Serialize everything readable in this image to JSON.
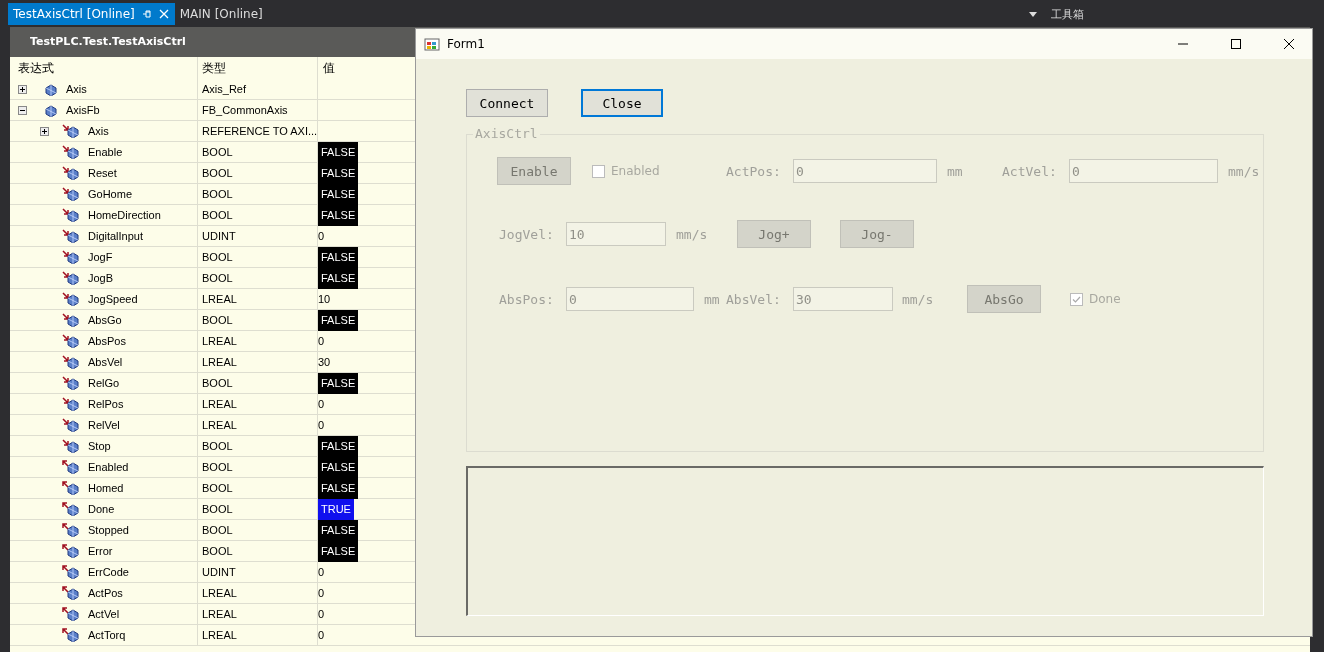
{
  "ide": {
    "tabs": [
      {
        "label": "TestAxisCtrl [Online]",
        "selected": true
      },
      {
        "label": "MAIN [Online]",
        "selected": false
      }
    ],
    "toolbox_label": "工具箱"
  },
  "watch": {
    "title": "TestPLC.Test.TestAxisCtrl",
    "columns": [
      "表达式",
      "类型",
      "值"
    ],
    "rows": [
      {
        "name": "Axis",
        "type": "Axis_Ref",
        "kind": "var",
        "expanded": false
      },
      {
        "name": "AxisFb",
        "type": "FB_CommonAxis",
        "kind": "var",
        "expanded": true,
        "children": [
          {
            "name": "Axis",
            "type": "REFERENCE TO AXI...",
            "kind": "input",
            "expanded": false
          },
          {
            "name": "Enable",
            "type": "BOOL",
            "kind": "input",
            "value": {
              "text": "FALSE",
              "kind": "bool",
              "on": false
            }
          },
          {
            "name": "Reset",
            "type": "BOOL",
            "kind": "input",
            "value": {
              "text": "FALSE",
              "kind": "bool",
              "on": false
            }
          },
          {
            "name": "GoHome",
            "type": "BOOL",
            "kind": "input",
            "value": {
              "text": "FALSE",
              "kind": "bool",
              "on": false
            }
          },
          {
            "name": "HomeDirection",
            "type": "BOOL",
            "kind": "input",
            "value": {
              "text": "FALSE",
              "kind": "bool",
              "on": false
            }
          },
          {
            "name": "DigitalInput",
            "type": "UDINT",
            "kind": "input",
            "value": {
              "text": "0",
              "kind": "number"
            }
          },
          {
            "name": "JogF",
            "type": "BOOL",
            "kind": "input",
            "value": {
              "text": "FALSE",
              "kind": "bool",
              "on": false
            }
          },
          {
            "name": "JogB",
            "type": "BOOL",
            "kind": "input",
            "value": {
              "text": "FALSE",
              "kind": "bool",
              "on": false
            }
          },
          {
            "name": "JogSpeed",
            "type": "LREAL",
            "kind": "input",
            "value": {
              "text": "10",
              "kind": "number"
            }
          },
          {
            "name": "AbsGo",
            "type": "BOOL",
            "kind": "input",
            "value": {
              "text": "FALSE",
              "kind": "bool",
              "on": false
            }
          },
          {
            "name": "AbsPos",
            "type": "LREAL",
            "kind": "input",
            "value": {
              "text": "0",
              "kind": "number"
            }
          },
          {
            "name": "AbsVel",
            "type": "LREAL",
            "kind": "input",
            "value": {
              "text": "30",
              "kind": "number"
            }
          },
          {
            "name": "RelGo",
            "type": "BOOL",
            "kind": "input",
            "value": {
              "text": "FALSE",
              "kind": "bool",
              "on": false
            }
          },
          {
            "name": "RelPos",
            "type": "LREAL",
            "kind": "input",
            "value": {
              "text": "0",
              "kind": "number"
            }
          },
          {
            "name": "RelVel",
            "type": "LREAL",
            "kind": "input",
            "value": {
              "text": "0",
              "kind": "number"
            }
          },
          {
            "name": "Stop",
            "type": "BOOL",
            "kind": "input",
            "value": {
              "text": "FALSE",
              "kind": "bool",
              "on": false
            }
          },
          {
            "name": "Enabled",
            "type": "BOOL",
            "kind": "output",
            "value": {
              "text": "FALSE",
              "kind": "bool",
              "on": false
            }
          },
          {
            "name": "Homed",
            "type": "BOOL",
            "kind": "output",
            "value": {
              "text": "FALSE",
              "kind": "bool",
              "on": false
            }
          },
          {
            "name": "Done",
            "type": "BOOL",
            "kind": "output",
            "value": {
              "text": "TRUE",
              "kind": "bool",
              "on": true
            }
          },
          {
            "name": "Stopped",
            "type": "BOOL",
            "kind": "output",
            "value": {
              "text": "FALSE",
              "kind": "bool",
              "on": false
            }
          },
          {
            "name": "Error",
            "type": "BOOL",
            "kind": "output",
            "value": {
              "text": "FALSE",
              "kind": "bool",
              "on": false
            }
          },
          {
            "name": "ErrCode",
            "type": "UDINT",
            "kind": "output",
            "value": {
              "text": "0",
              "kind": "number"
            }
          },
          {
            "name": "ActPos",
            "type": "LREAL",
            "kind": "output",
            "value": {
              "text": "0",
              "kind": "number"
            }
          },
          {
            "name": "ActVel",
            "type": "LREAL",
            "kind": "output",
            "value": {
              "text": "0",
              "kind": "number"
            }
          },
          {
            "name": "ActTorq",
            "type": "LREAL",
            "kind": "output",
            "value": {
              "text": "0",
              "kind": "number"
            }
          }
        ]
      }
    ]
  },
  "form": {
    "title": "Form1",
    "buttons": [
      {
        "label": "Connect",
        "focused": false
      },
      {
        "label": "Close",
        "focused": true
      }
    ],
    "group": {
      "title": "AxisCtrl",
      "rows": [
        {
          "items": [
            {
              "kind": "button",
              "label": "Enable",
              "disabled": true
            },
            {
              "kind": "checkbox",
              "label": "Enabled",
              "checked": false
            },
            {
              "kind": "label",
              "text": "ActPos:"
            },
            {
              "kind": "field",
              "value": "0"
            },
            {
              "kind": "unit",
              "text": "mm"
            },
            {
              "kind": "label",
              "text": "ActVel:"
            },
            {
              "kind": "field",
              "value": "0"
            },
            {
              "kind": "unit",
              "text": "mm/s"
            }
          ]
        },
        {
          "items": [
            {
              "kind": "label",
              "text": "JogVel:"
            },
            {
              "kind": "field",
              "value": "10"
            },
            {
              "kind": "unit",
              "text": "mm/s"
            },
            {
              "kind": "button",
              "label": "Jog+",
              "disabled": true
            },
            {
              "kind": "button",
              "label": "Jog-",
              "disabled": true
            }
          ]
        },
        {
          "items": [
            {
              "kind": "label",
              "text": "AbsPos:"
            },
            {
              "kind": "field",
              "value": "0"
            },
            {
              "kind": "unit",
              "text": "mm"
            },
            {
              "kind": "label",
              "text": "AbsVel:"
            },
            {
              "kind": "field",
              "value": "30"
            },
            {
              "kind": "unit",
              "text": "mm/s"
            },
            {
              "kind": "button",
              "label": "AbsGo",
              "disabled": true
            },
            {
              "kind": "checkbox",
              "label": "Done",
              "checked": true
            }
          ]
        }
      ]
    }
  }
}
